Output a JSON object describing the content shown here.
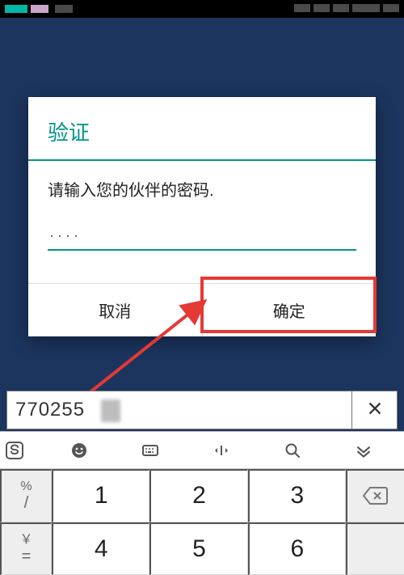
{
  "dialog": {
    "title": "验证",
    "message": "请输入您的伙伴的密码.",
    "password_value": "····",
    "cancel_label": "取消",
    "confirm_label": "确定"
  },
  "id_field": {
    "value": "770255"
  },
  "keyboard": {
    "side_keys": [
      {
        "top": "%",
        "bot": "/"
      },
      {
        "top": "￥",
        "bot": "="
      }
    ],
    "num_row1": [
      "1",
      "2",
      "3"
    ],
    "num_row2": [
      "4",
      "5",
      "6"
    ]
  },
  "annotation": {
    "highlight_target": "confirm-button"
  }
}
